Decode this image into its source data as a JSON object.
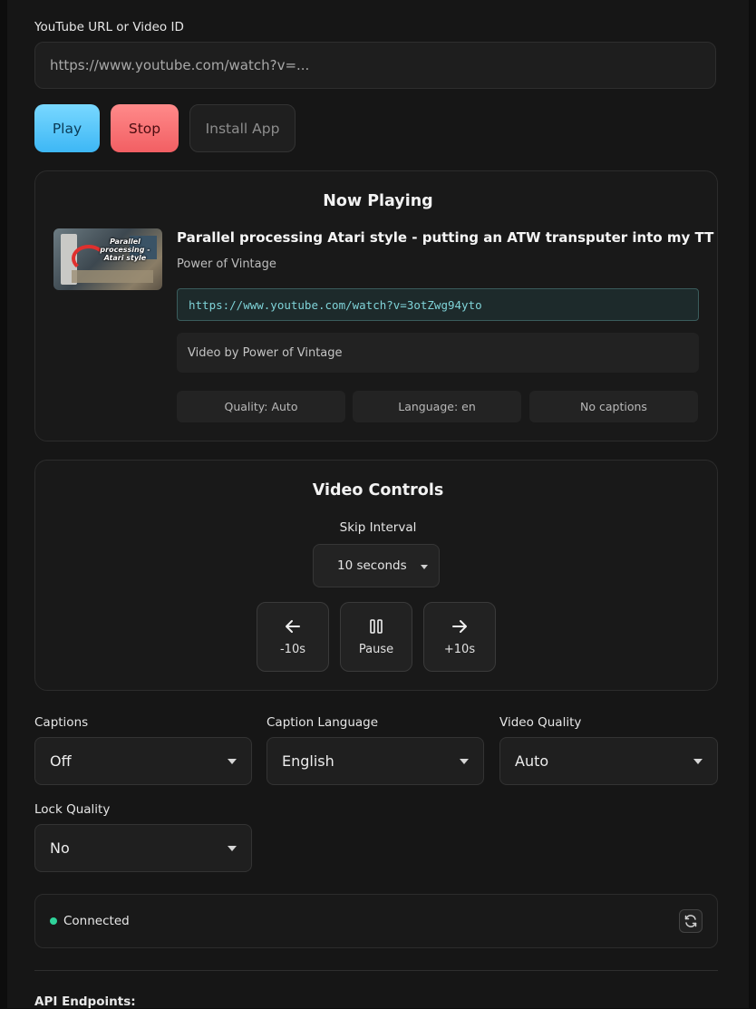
{
  "url_field": {
    "label": "YouTube URL or Video ID",
    "placeholder": "https://www.youtube.com/watch?v=..."
  },
  "buttons": {
    "play": "Play",
    "stop": "Stop",
    "install": "Install App"
  },
  "now_playing": {
    "heading": "Now Playing",
    "thumbnail_text": "Parallel processing - Atari style",
    "title": "Parallel processing Atari style - putting an ATW transputer into my TT",
    "channel": "Power of Vintage",
    "link": "https://www.youtube.com/watch?v=3otZwg94yto",
    "description": "Video by Power of Vintage",
    "quality": "Quality: Auto",
    "language": "Language: en",
    "captions": "No captions"
  },
  "video_controls": {
    "heading": "Video Controls",
    "skip_label": "Skip Interval",
    "skip_value": "10 seconds",
    "back_label": "-10s",
    "pause_label": "Pause",
    "forward_label": "+10s"
  },
  "settings": {
    "captions_label": "Captions",
    "captions_value": "Off",
    "caption_language_label": "Caption Language",
    "caption_language_value": "English",
    "video_quality_label": "Video Quality",
    "video_quality_value": "Auto",
    "lock_quality_label": "Lock Quality",
    "lock_quality_value": "No"
  },
  "status": {
    "text": "Connected",
    "color": "#2fd39a"
  },
  "api": {
    "heading": "API Endpoints:"
  },
  "colors": {
    "play": "#3db7f5",
    "stop": "#f25f63",
    "link": "#7fd3d8"
  }
}
